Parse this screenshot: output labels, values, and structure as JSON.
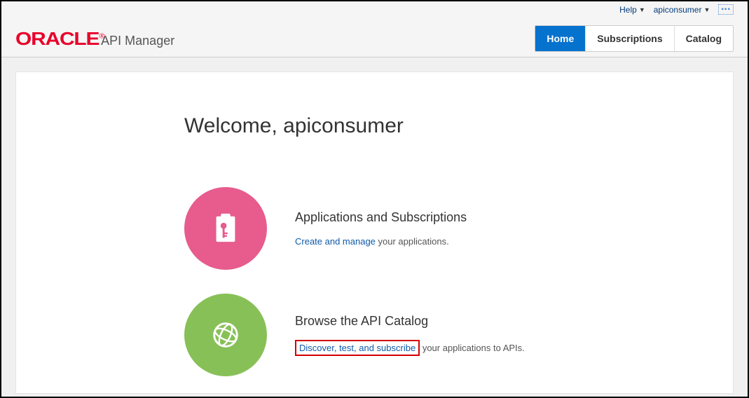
{
  "util": {
    "help_label": "Help",
    "user_label": "apiconsumer"
  },
  "brand": {
    "logo_text": "ORACLE",
    "reg": "®",
    "product": "API Manager"
  },
  "nav": {
    "home": "Home",
    "subscriptions": "Subscriptions",
    "catalog": "Catalog"
  },
  "welcome": "Welcome, apiconsumer",
  "apps": {
    "title": "Applications and Subscriptions",
    "link": "Create and manage",
    "rest": " your applications."
  },
  "catalog_section": {
    "title": "Browse the API Catalog",
    "link": "Discover, test, and subscribe",
    "rest": " your applications to APIs."
  }
}
